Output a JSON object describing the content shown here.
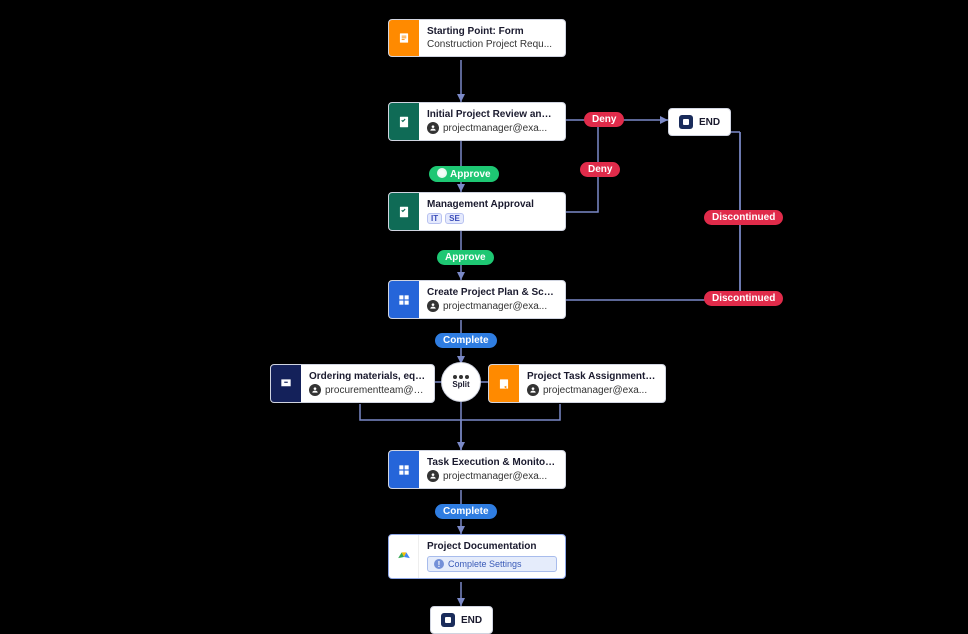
{
  "nodes": {
    "start": {
      "title": "Starting Point: Form",
      "subtitle": "Construction Project Requ..."
    },
    "review": {
      "title": "Initial Project Review and Fe...",
      "assignee": "projectmanager@exa..."
    },
    "approval": {
      "title": "Management Approval",
      "badges": [
        "IT",
        "SE"
      ]
    },
    "plan": {
      "title": "Create Project Plan & Sched...",
      "assignee": "projectmanager@exa..."
    },
    "ordering": {
      "title": "Ordering materials, equipme...",
      "assignee": "procurementteam@ex..."
    },
    "taskform": {
      "title": "Project Task Assignment Form",
      "assignee": "projectmanager@exa..."
    },
    "exec": {
      "title": "Task Execution & Monitoring",
      "assignee": "projectmanager@exa..."
    },
    "docs": {
      "title": "Project Documentation",
      "button": "Complete Settings"
    }
  },
  "pills": {
    "approve1": "Approve",
    "approve2": "Approve",
    "deny1": "Deny",
    "deny2": "Deny",
    "disc1": "Discontinued",
    "disc2": "Discontinued",
    "complete1": "Complete",
    "complete2": "Complete"
  },
  "split_label": "Split",
  "end_label": "END"
}
